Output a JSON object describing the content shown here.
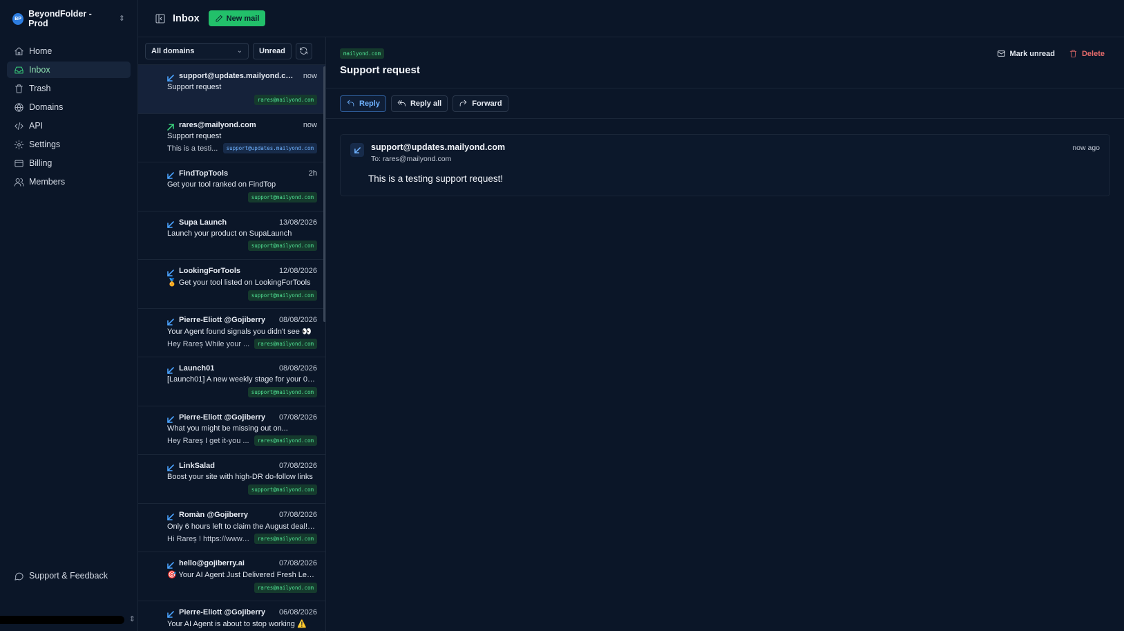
{
  "workspace": {
    "initials": "BP",
    "name": "BeyondFolder - Prod"
  },
  "nav": [
    {
      "label": "Home",
      "icon": "home-icon"
    },
    {
      "label": "Inbox",
      "icon": "inbox-icon",
      "active": true
    },
    {
      "label": "Trash",
      "icon": "trash-icon"
    },
    {
      "label": "Domains",
      "icon": "globe-icon"
    },
    {
      "label": "API",
      "icon": "code-icon"
    },
    {
      "label": "Settings",
      "icon": "gear-icon"
    },
    {
      "label": "Billing",
      "icon": "credit-card-icon"
    },
    {
      "label": "Members",
      "icon": "users-icon"
    }
  ],
  "support_label": "Support & Feedback",
  "topbar": {
    "title": "Inbox",
    "new_mail_label": "New mail"
  },
  "filters": {
    "domain_selected": "All domains",
    "unread_label": "Unread"
  },
  "mails": [
    {
      "from": "support@updates.mailyond.com",
      "time": "now",
      "subject": "Support request",
      "preview": "",
      "tag": "rares@mailyond.com",
      "tag_color": "green",
      "direction": "in"
    },
    {
      "from": "rares@mailyond.com",
      "time": "now",
      "subject": "Support request",
      "preview": "This is a testi...",
      "tag": "support@updates.mailyond.com",
      "tag_color": "blue",
      "direction": "out"
    },
    {
      "from": "FindTopTools",
      "time": "2h",
      "subject": "Get your tool ranked on FindTop",
      "preview": "",
      "tag": "support@mailyond.com",
      "tag_color": "green",
      "direction": "in"
    },
    {
      "from": "Supa Launch",
      "time": "13/08/2026",
      "subject": "Launch your product on SupaLaunch",
      "preview": "",
      "tag": "support@mailyond.com",
      "tag_color": "green",
      "direction": "in"
    },
    {
      "from": "LookingForTools",
      "time": "12/08/2026",
      "subject": "🏅 Get your tool listed on LookingForTools",
      "preview": "",
      "tag": "support@mailyond.com",
      "tag_color": "green",
      "direction": "in"
    },
    {
      "from": "Pierre-Eliott @Gojiberry",
      "time": "08/08/2026",
      "subject": "Your Agent found signals you didn't see 👀",
      "preview": "Hey Rareș While your ...",
      "tag": "rares@mailyond.com",
      "tag_color": "green",
      "direction": "in"
    },
    {
      "from": "Launch01",
      "time": "08/08/2026",
      "subject": "[Launch01] A new weekly stage for your 0-to...",
      "preview": "",
      "tag": "support@mailyond.com",
      "tag_color": "green",
      "direction": "in"
    },
    {
      "from": "Pierre-Eliott @Gojiberry",
      "time": "07/08/2026",
      "subject": "What you might be missing out on...",
      "preview": "Hey Rareș I get it-you ...",
      "tag": "rares@mailyond.com",
      "tag_color": "green",
      "direction": "in"
    },
    {
      "from": "LinkSalad",
      "time": "07/08/2026",
      "subject": "Boost your site with high-DR do-follow links",
      "preview": "",
      "tag": "support@mailyond.com",
      "tag_color": "green",
      "direction": "in"
    },
    {
      "from": "Romàn @Gojiberry",
      "time": "07/08/2026",
      "subject": "Only 6 hours left to claim the August deal! ⏳",
      "preview": "Hi Rareș ! https://www....",
      "tag": "rares@mailyond.com",
      "tag_color": "green",
      "direction": "in"
    },
    {
      "from": "hello@gojiberry.ai",
      "time": "07/08/2026",
      "subject": "🎯 Your AI Agent Just Delivered Fresh Leads!",
      "preview": "",
      "tag": "rares@mailyond.com",
      "tag_color": "green",
      "direction": "in"
    },
    {
      "from": "Pierre-Eliott @Gojiberry",
      "time": "06/08/2026",
      "subject": "Your AI Agent is about to stop working ⚠️",
      "preview": "",
      "tag": "",
      "tag_color": "green",
      "direction": "in"
    }
  ],
  "detail": {
    "domain_tag": "mailyond.com",
    "subject": "Support request",
    "mark_unread_label": "Mark unread",
    "delete_label": "Delete",
    "reply_label": "Reply",
    "reply_all_label": "Reply all",
    "forward_label": "Forward",
    "message": {
      "from": "support@updates.mailyond.com",
      "to": "To: rares@mailyond.com",
      "time": "now ago",
      "body": "This is a testing support request!"
    }
  },
  "colors": {
    "accent_green": "#22c06a",
    "accent_blue": "#4aa3ff",
    "danger": "#e36a6a",
    "background": "#0b1628"
  }
}
